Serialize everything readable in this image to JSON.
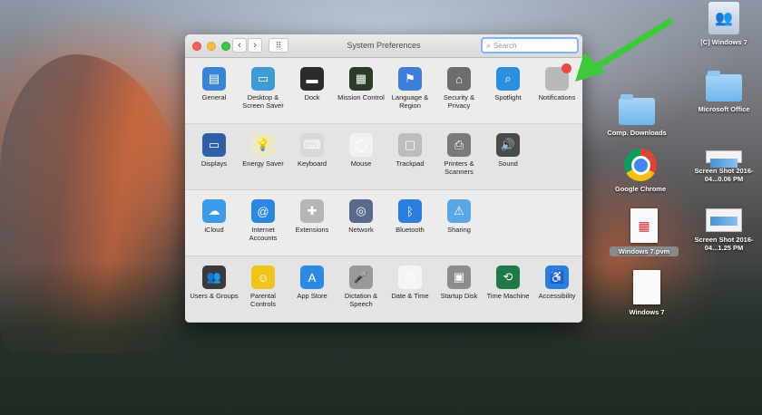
{
  "window": {
    "title": "System Preferences",
    "search_placeholder": "Search",
    "nav_back": "‹",
    "nav_forward": "›",
    "grid_glyph": "⠿"
  },
  "sections": [
    {
      "panes": [
        {
          "label": "General",
          "icon": "general-icon",
          "color": "#3a84d8",
          "glyph": "▤"
        },
        {
          "label": "Desktop & Screen Saver",
          "icon": "desktop-icon",
          "color": "#3e9bd6",
          "glyph": "▭"
        },
        {
          "label": "Dock",
          "icon": "dock-icon",
          "color": "#2b2b2b",
          "glyph": "▬"
        },
        {
          "label": "Mission Control",
          "icon": "mission-control-icon",
          "color": "#2d3b2b",
          "glyph": "▦"
        },
        {
          "label": "Language & Region",
          "icon": "flag-icon",
          "color": "#3d7ed6",
          "glyph": "⚑"
        },
        {
          "label": "Security & Privacy",
          "icon": "house-lock-icon",
          "color": "#6d6d6d",
          "glyph": "⌂"
        },
        {
          "label": "Spotlight",
          "icon": "magnifier-icon",
          "color": "#2a8fe0",
          "glyph": "⌕"
        },
        {
          "label": "Notifications",
          "icon": "notifications-icon",
          "color": "#b8b8b8",
          "glyph": ""
        }
      ]
    },
    {
      "panes": [
        {
          "label": "Displays",
          "icon": "display-icon",
          "color": "#2f5fa8",
          "glyph": "▭"
        },
        {
          "label": "Energy Saver",
          "icon": "lightbulb-icon",
          "color": "#ece9c7",
          "glyph": "💡"
        },
        {
          "label": "Keyboard",
          "icon": "keyboard-icon",
          "color": "#d9d9d9",
          "glyph": "⌨"
        },
        {
          "label": "Mouse",
          "icon": "mouse-icon",
          "color": "#f2f2f2",
          "glyph": "◯"
        },
        {
          "label": "Trackpad",
          "icon": "trackpad-icon",
          "color": "#bdbdbd",
          "glyph": "▢"
        },
        {
          "label": "Printers & Scanners",
          "icon": "printer-icon",
          "color": "#7a7a7a",
          "glyph": "⎙"
        },
        {
          "label": "Sound",
          "icon": "speaker-icon",
          "color": "#4a4a4a",
          "glyph": "🔊"
        }
      ]
    },
    {
      "panes": [
        {
          "label": "iCloud",
          "icon": "cloud-icon",
          "color": "#3b9be8",
          "glyph": "☁"
        },
        {
          "label": "Internet Accounts",
          "icon": "at-icon",
          "color": "#2a86de",
          "glyph": "@"
        },
        {
          "label": "Extensions",
          "icon": "puzzle-icon",
          "color": "#b5b5b5",
          "glyph": "✚"
        },
        {
          "label": "Network",
          "icon": "globe-icon",
          "color": "#5a6a8c",
          "glyph": "◎"
        },
        {
          "label": "Bluetooth",
          "icon": "bluetooth-icon",
          "color": "#2a7ee0",
          "glyph": "ᛒ"
        },
        {
          "label": "Sharing",
          "icon": "folder-sign-icon",
          "color": "#59a7e4",
          "glyph": "⚠"
        }
      ]
    },
    {
      "panes": [
        {
          "label": "Users & Groups",
          "icon": "users-icon",
          "color": "#3a3a3a",
          "glyph": "👥"
        },
        {
          "label": "Parental Controls",
          "icon": "parental-icon",
          "color": "#f0c419",
          "glyph": "☺"
        },
        {
          "label": "App Store",
          "icon": "appstore-icon",
          "color": "#2a8ae6",
          "glyph": "A"
        },
        {
          "label": "Dictation & Speech",
          "icon": "microphone-icon",
          "color": "#9a9a9a",
          "glyph": "🎤"
        },
        {
          "label": "Date & Time",
          "icon": "clock-icon",
          "color": "#f5f5f5",
          "glyph": "◷"
        },
        {
          "label": "Startup Disk",
          "icon": "disk-icon",
          "color": "#8c8c8c",
          "glyph": "▣"
        },
        {
          "label": "Time Machine",
          "icon": "timemachine-icon",
          "color": "#1f7a4a",
          "glyph": "⟲"
        },
        {
          "label": "Accessibility",
          "icon": "accessibility-icon",
          "color": "#2a7ee0",
          "glyph": "♿"
        }
      ]
    }
  ],
  "desktop": {
    "items": [
      {
        "label": "[C] Windows 7",
        "icon": "network-drive-icon"
      },
      {
        "label": "Microsoft Office",
        "icon": "folder-icon"
      },
      {
        "label": "Comp. Downloads",
        "icon": "folder-icon"
      },
      {
        "label": "Screen Shot 2016-04...0.06 PM",
        "icon": "screenshot-icon"
      },
      {
        "label": "Google Chrome",
        "icon": "chrome-icon"
      },
      {
        "label": "Windows 7.pvm",
        "icon": "pvm-file-icon"
      },
      {
        "label": "Screen Shot 2016-04...1.25 PM",
        "icon": "screenshot-icon"
      },
      {
        "label": "Windows 7",
        "icon": "document-icon"
      }
    ]
  },
  "annotation": {
    "arrow_color": "#3ec93a"
  }
}
